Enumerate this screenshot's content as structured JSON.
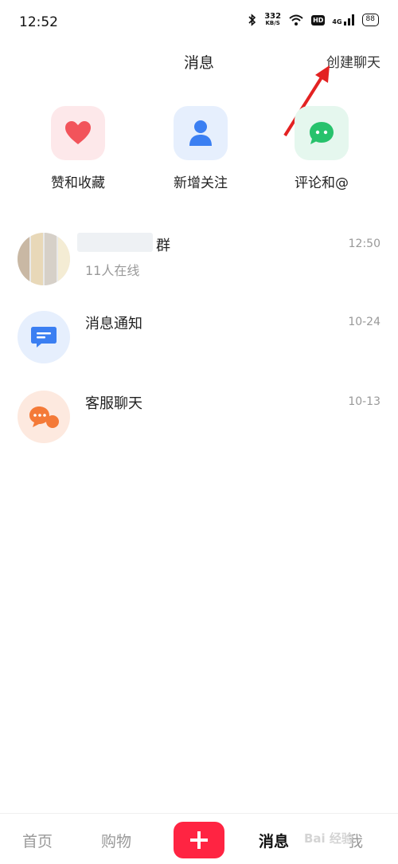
{
  "status_bar": {
    "time": "12:52",
    "speed_value": "332",
    "speed_unit": "KB/S",
    "hd": "HD",
    "network": "4G",
    "battery": "88"
  },
  "header": {
    "title": "消息",
    "create_chat": "创建聊天"
  },
  "quick_actions": [
    {
      "label": "赞和收藏",
      "icon": "heart-icon",
      "color": "#f2545b"
    },
    {
      "label": "新增关注",
      "icon": "person-icon",
      "color": "#3b7ff2"
    },
    {
      "label": "评论和@",
      "icon": "chat-bubble-icon",
      "color": "#27c26c"
    }
  ],
  "messages": [
    {
      "title": "群",
      "subtitle": "11人在线",
      "time": "12:50",
      "avatar": "group-avatar"
    },
    {
      "title": "消息通知",
      "subtitle": "",
      "time": "10-24",
      "avatar": "notification-icon"
    },
    {
      "title": "客服聊天",
      "subtitle": "",
      "time": "10-13",
      "avatar": "customer-service-icon"
    }
  ],
  "tabbar": {
    "home": "首页",
    "shop": "购物",
    "messages": "消息",
    "me": "我",
    "accent": "#ff2442"
  },
  "watermark": "Bai 经验"
}
